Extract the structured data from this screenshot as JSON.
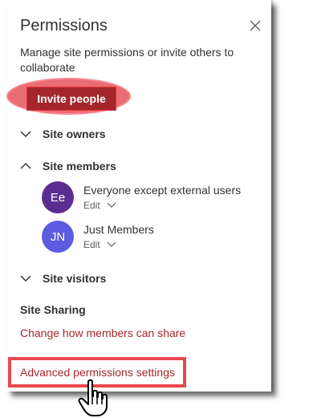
{
  "panel": {
    "title": "Permissions",
    "description": "Manage site permissions or invite others to collaborate",
    "invite_button": "Invite people"
  },
  "sections": {
    "owners": "Site owners",
    "members": "Site members",
    "visitors": "Site visitors"
  },
  "members": [
    {
      "initials": "Ee",
      "name": "Everyone except external users",
      "role": "Edit",
      "color": "#5c2d91"
    },
    {
      "initials": "JN",
      "name": "Just Members",
      "role": "Edit",
      "color": "#5c5ce0"
    }
  ],
  "sharing": {
    "title": "Site Sharing",
    "change_link": "Change how members can share",
    "advanced_link": "Advanced permissions settings"
  },
  "colors": {
    "accent": "#a4262c",
    "highlight": "#e8484f"
  },
  "icons": {
    "close": "close-icon",
    "chevron_down": "chevron-down-icon",
    "chevron_up": "chevron-up-icon",
    "cursor": "hand-pointer-icon"
  }
}
